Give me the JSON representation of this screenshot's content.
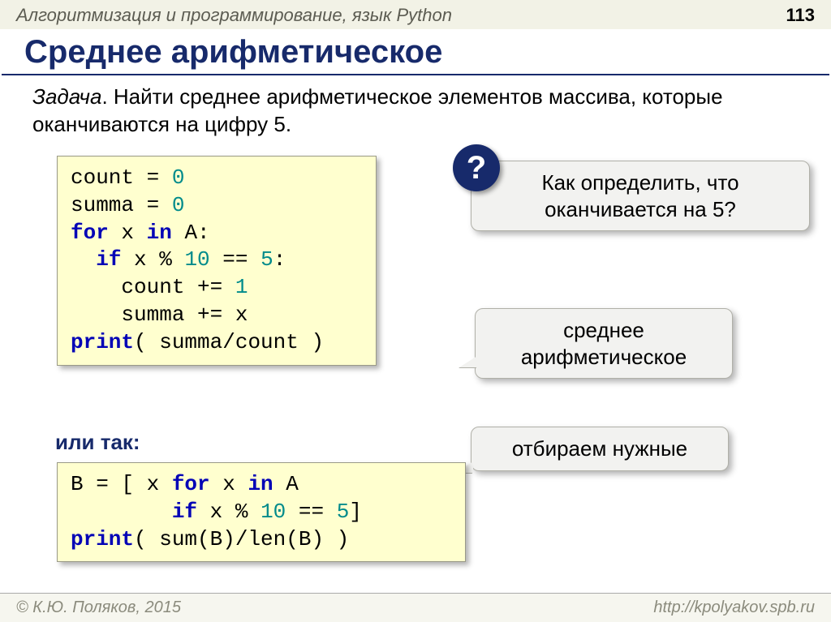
{
  "header": {
    "subject": "Алгоритмизация и программирование, язык Python",
    "page": "113"
  },
  "title": "Среднее арифметическое",
  "task": {
    "label": "Задача",
    "text": ". Найти среднее арифметическое элементов массива, которые оканчиваются на цифру 5."
  },
  "code1": {
    "l1a": "count",
    "l1b": " = ",
    "l1c": "0",
    "l2a": "summa",
    "l2b": " = ",
    "l2c": "0",
    "l3a": "for",
    "l3b": " x ",
    "l3c": "in",
    "l3d": " A:",
    "l4a": "  ",
    "l4b": "if",
    "l4c": " x % ",
    "l4d": "10",
    "l4e": " == ",
    "l4f": "5",
    "l4g": ":",
    "l5a": "    count += ",
    "l5b": "1",
    "l6a": "    summa += x",
    "l7a": "print",
    "l7b": "( summa/count )"
  },
  "or_label": "или так:",
  "code2": {
    "l1a": "B = [ x ",
    "l1b": "for",
    "l1c": " x ",
    "l1d": "in",
    "l1e": " A",
    "l2a": "        ",
    "l2b": "if",
    "l2c": " x % ",
    "l2d": "10",
    "l2e": " == ",
    "l2f": "5",
    "l2g": "]",
    "l3a": "print",
    "l3b": "( sum(B)/len(B) )"
  },
  "callouts": {
    "question_badge": "?",
    "question": "Как определить, что оканчивается на 5?",
    "avg": "среднее арифметическое",
    "select": "отбираем нужные"
  },
  "footer": {
    "left": "© К.Ю. Поляков, 2015",
    "right": "http://kpolyakov.spb.ru"
  }
}
